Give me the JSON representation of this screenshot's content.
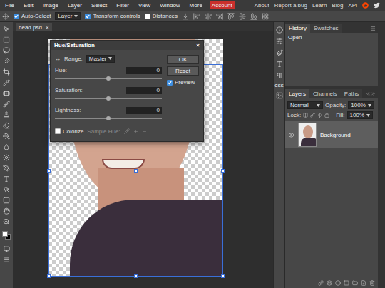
{
  "menu_bar": {
    "items": [
      {
        "label": "File",
        "selected": false
      },
      {
        "label": "Edit",
        "selected": false
      },
      {
        "label": "Image",
        "selected": false
      },
      {
        "label": "Layer",
        "selected": false
      },
      {
        "label": "Select",
        "selected": false
      },
      {
        "label": "Filter",
        "selected": false
      },
      {
        "label": "View",
        "selected": false
      },
      {
        "label": "Window",
        "selected": false
      },
      {
        "label": "More",
        "selected": false
      },
      {
        "label": "Account",
        "selected": true
      }
    ],
    "links": [
      "About",
      "Report a bug",
      "Learn",
      "Blog",
      "API"
    ]
  },
  "options_bar": {
    "auto_select": {
      "label": "Auto-Select",
      "checked": true
    },
    "layer_select": "Layer",
    "transform_controls": {
      "label": "Transform controls",
      "checked": true
    },
    "distances": {
      "label": "Distances",
      "checked": false
    }
  },
  "document_tab": {
    "title": "head.psd",
    "close": "×"
  },
  "dialog": {
    "title": "Hue/Saturation",
    "close": "×",
    "range_icon": "↔",
    "range_label": "Range:",
    "range_value": "Master",
    "sliders": [
      {
        "label": "Hue:",
        "value": "0",
        "level": 0.5
      },
      {
        "label": "Saturation:",
        "value": "0",
        "level": 0.5
      },
      {
        "label": "Lightness:",
        "value": "0",
        "level": 0.5
      }
    ],
    "colorize": {
      "label": "Colorize",
      "checked": false
    },
    "sample_hue": {
      "label": "Sample Hue:",
      "disabled": true
    },
    "buttons": [
      "OK",
      "Reset"
    ],
    "preview": {
      "label": "Preview",
      "checked": true
    }
  },
  "side_icons": {
    "css_label": "CSS"
  },
  "history_panel": {
    "tabs": [
      {
        "label": "History",
        "selected": true
      },
      {
        "label": "Swatches",
        "selected": false
      }
    ],
    "items": [
      "Open"
    ]
  },
  "layers_panel": {
    "tabs": [
      {
        "label": "Layers",
        "selected": true
      },
      {
        "label": "Channels",
        "selected": false
      },
      {
        "label": "Paths",
        "selected": false
      }
    ],
    "blend_mode": "Normal",
    "opacity_label": "Opacity:",
    "opacity": "100%",
    "lock_label": "Lock:",
    "fill_label": "Fill:",
    "fill": "100%",
    "layers": [
      {
        "name": "Background",
        "visible": true,
        "selected": true
      }
    ]
  }
}
